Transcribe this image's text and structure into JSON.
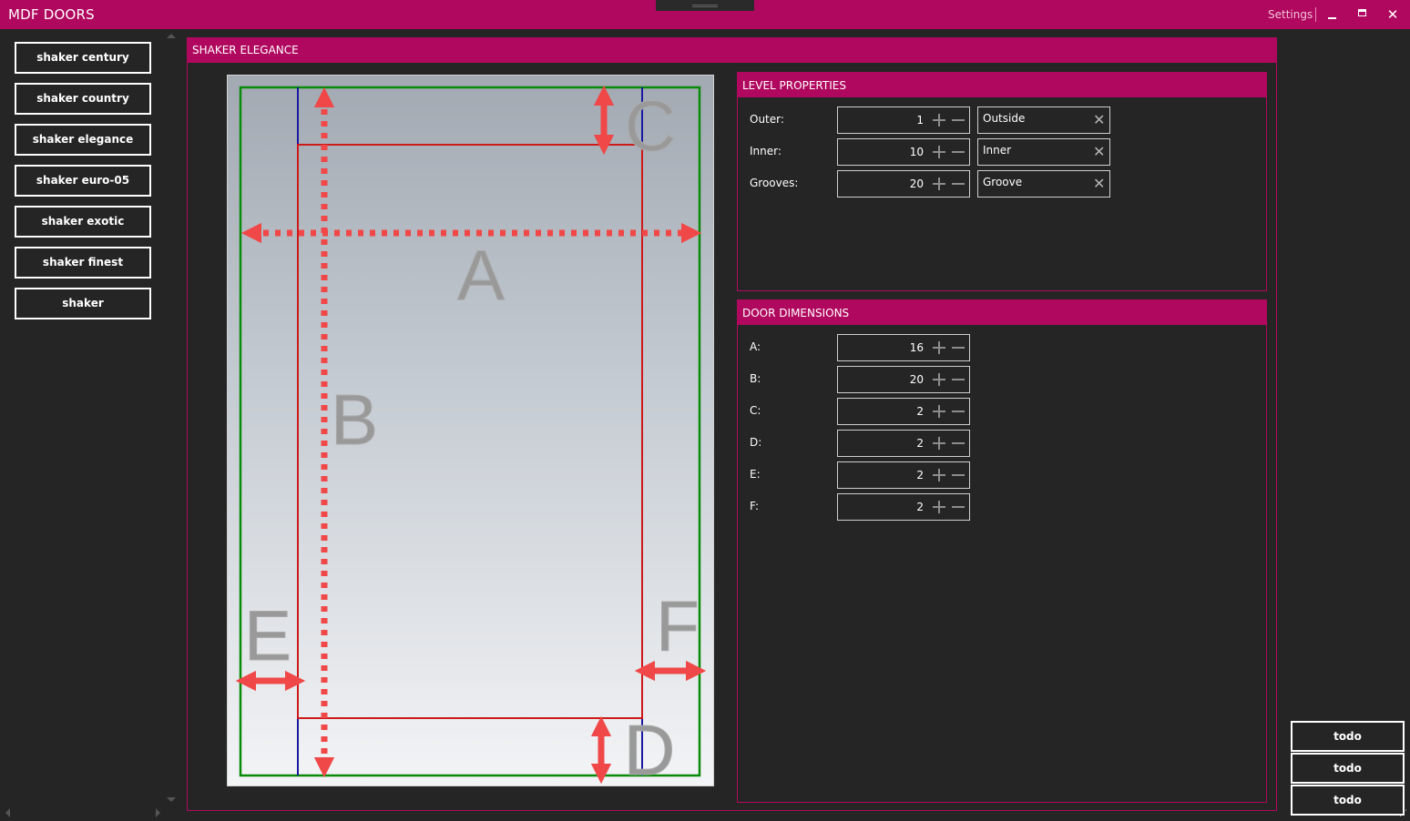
{
  "window": {
    "title": "MDF DOORS",
    "settings_label": "Settings",
    "accent_color": "#b0085e",
    "background_color": "#252525"
  },
  "door_styles": [
    "shaker century",
    "shaker country",
    "shaker elegance",
    "shaker euro-05",
    "shaker exotic",
    "shaker finest",
    "shaker"
  ],
  "main": {
    "title": "SHAKER ELEGANCE",
    "diagram": {
      "labels": {
        "a": "A",
        "b": "B",
        "c": "C",
        "d": "D",
        "e": "E",
        "f": "F"
      },
      "colors": {
        "outer": "#0a8a0a",
        "inner": "#cc1a1a",
        "groove": "#1a1a9e",
        "arrows": "#f04848",
        "letters": "#999999"
      }
    },
    "level_properties": {
      "title": "LEVEL PROPERTIES",
      "rows": [
        {
          "label": "Outer:",
          "value": "1",
          "text": "Outside"
        },
        {
          "label": "Inner:",
          "value": "10",
          "text": "Inner"
        },
        {
          "label": "Grooves:",
          "value": "20",
          "text": "Groove"
        }
      ]
    },
    "door_dimensions": {
      "title": "DOOR DIMENSIONS",
      "rows": [
        {
          "label": "A:",
          "value": "16"
        },
        {
          "label": "B:",
          "value": "20"
        },
        {
          "label": "C:",
          "value": "2"
        },
        {
          "label": "D:",
          "value": "2"
        },
        {
          "label": "E:",
          "value": "2"
        },
        {
          "label": "F:",
          "value": "2"
        }
      ]
    }
  },
  "actions": [
    "todo",
    "todo",
    "todo"
  ],
  "icons": {
    "minimize": "minimize-icon",
    "maximize": "maximize-icon",
    "close": "close-icon",
    "clear": "clear-icon",
    "plus": "plus-icon",
    "minus": "minus-icon"
  }
}
